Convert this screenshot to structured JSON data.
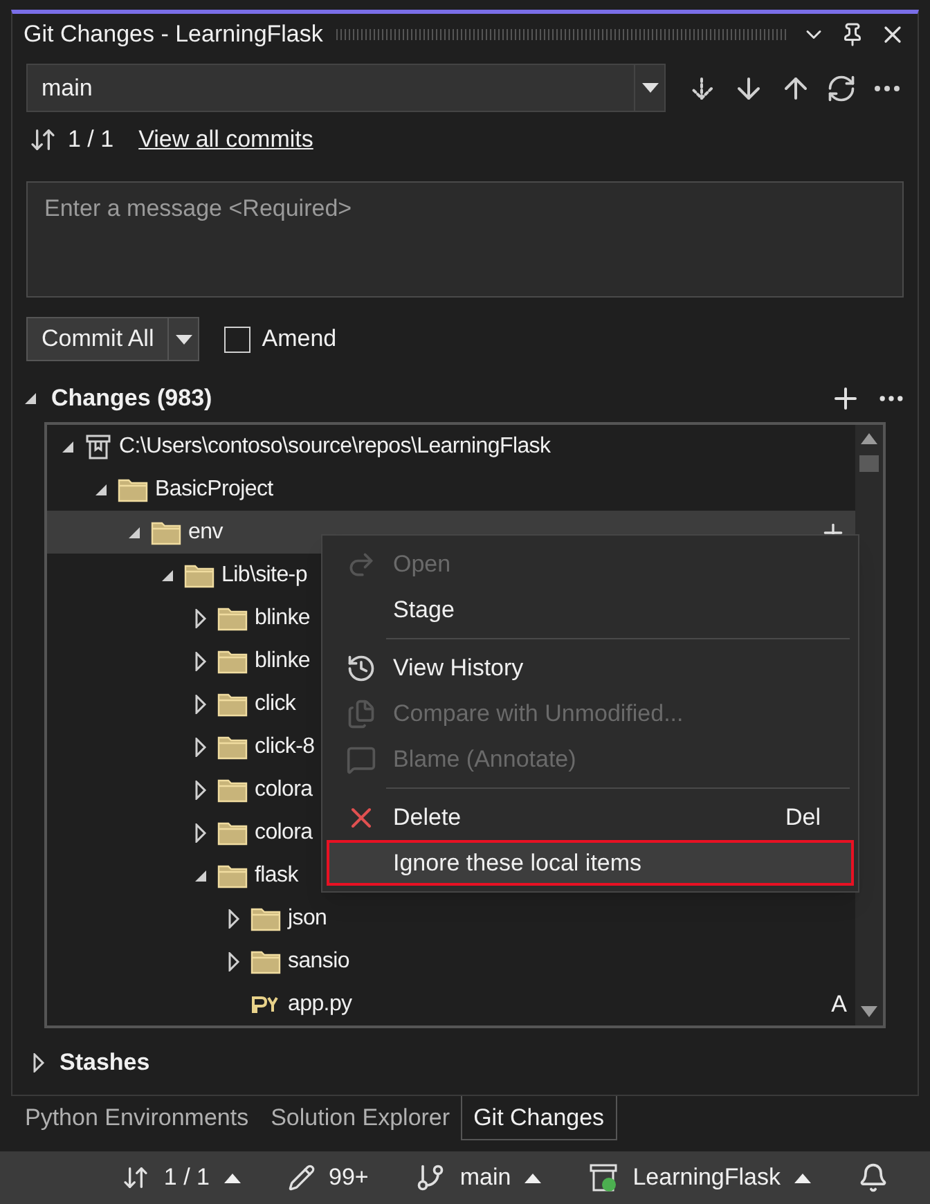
{
  "window": {
    "title": "Git Changes - LearningFlask"
  },
  "branch": {
    "value": "main"
  },
  "commits": {
    "count": "1 / 1",
    "link": "View all commits"
  },
  "message": {
    "placeholder": "Enter a message <Required>"
  },
  "commit": {
    "button": "Commit All",
    "amend": {
      "label": "Amend",
      "checked": false
    }
  },
  "changes": {
    "title": "Changes (983)",
    "expanded": true,
    "tree": [
      {
        "label": "C:\\Users\\contoso\\source\\repos\\LearningFlask",
        "kind": "repo",
        "expanded": true,
        "selected": false,
        "children": [
          {
            "label": "BasicProject",
            "kind": "folder",
            "expanded": true,
            "selected": false,
            "children": [
              {
                "label": "env",
                "kind": "folder",
                "expanded": true,
                "selected": true,
                "children": [
                  {
                    "label": "Lib\\site-p",
                    "kind": "folder",
                    "expanded": true,
                    "selected": false,
                    "children": [
                      {
                        "label": "blinke",
                        "kind": "folder",
                        "expanded": false,
                        "selected": false
                      },
                      {
                        "label": "blinke",
                        "kind": "folder",
                        "expanded": false,
                        "selected": false
                      },
                      {
                        "label": "click",
                        "kind": "folder",
                        "expanded": false,
                        "selected": false
                      },
                      {
                        "label": "click-8",
                        "kind": "folder",
                        "expanded": false,
                        "selected": false
                      },
                      {
                        "label": "colora",
                        "kind": "folder",
                        "expanded": false,
                        "selected": false
                      },
                      {
                        "label": "colora",
                        "kind": "folder",
                        "expanded": false,
                        "selected": false
                      },
                      {
                        "label": "flask",
                        "kind": "folder",
                        "expanded": true,
                        "selected": false,
                        "children": [
                          {
                            "label": "json",
                            "kind": "folder",
                            "expanded": false,
                            "selected": false
                          },
                          {
                            "label": "sansio",
                            "kind": "folder",
                            "expanded": false,
                            "selected": false
                          },
                          {
                            "label": "app.py",
                            "kind": "file",
                            "selected": false,
                            "status": "A"
                          }
                        ]
                      }
                    ]
                  }
                ]
              }
            ]
          }
        ]
      }
    ]
  },
  "context_menu": {
    "items": [
      {
        "kind": "item",
        "label": "Open",
        "disabled": true,
        "highlighted": false
      },
      {
        "kind": "item",
        "label": "Stage",
        "disabled": false,
        "highlighted": false
      },
      {
        "kind": "separator"
      },
      {
        "kind": "item",
        "label": "View History",
        "disabled": false,
        "highlighted": false
      },
      {
        "kind": "item",
        "label": "Compare with Unmodified...",
        "disabled": true,
        "highlighted": false
      },
      {
        "kind": "item",
        "label": "Blame (Annotate)",
        "disabled": true,
        "highlighted": false
      },
      {
        "kind": "separator"
      },
      {
        "kind": "item",
        "label": "Delete",
        "disabled": false,
        "highlighted": false,
        "shortcut": "Del"
      },
      {
        "kind": "item",
        "label": "Ignore these local items",
        "disabled": false,
        "highlighted": true
      }
    ]
  },
  "stashes": {
    "title": "Stashes",
    "expanded": false
  },
  "tabs": [
    {
      "label": "Python Environments",
      "selected": false
    },
    {
      "label": "Solution Explorer",
      "selected": false
    },
    {
      "label": "Git Changes",
      "selected": true
    }
  ],
  "status_bar": {
    "commits": "1 / 1",
    "changes": "99+",
    "branch": "main",
    "repo": "LearningFlask"
  }
}
